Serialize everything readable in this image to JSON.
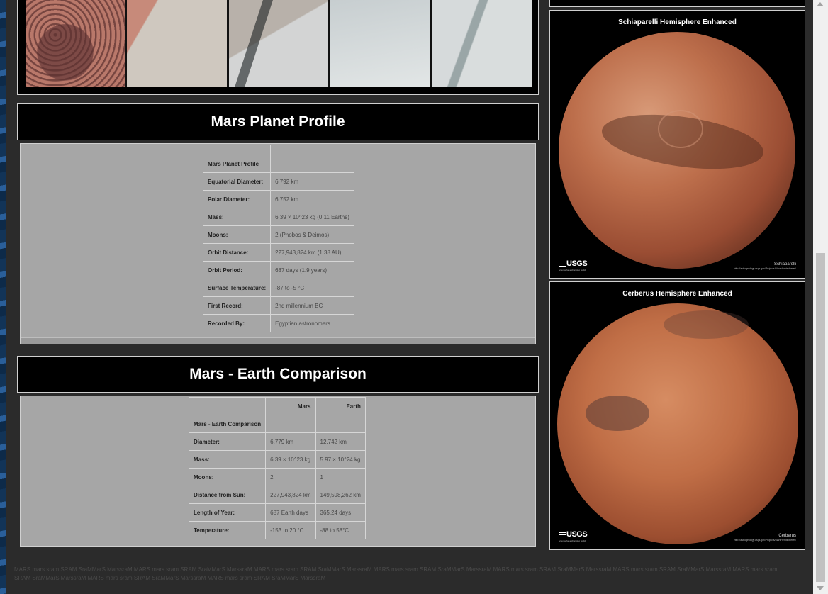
{
  "profile": {
    "heading": "Mars Planet Profile",
    "table_title": "Mars Planet Profile",
    "rows": [
      {
        "key": "Equatorial Diameter:",
        "value": "6,792 km"
      },
      {
        "key": "Polar Diameter:",
        "value": "6,752 km"
      },
      {
        "key": "Mass:",
        "value": "6.39 × 10^23 kg (0.11 Earths)"
      },
      {
        "key": "Moons:",
        "value": "2 (Phobos & Deimos)"
      },
      {
        "key": "Orbit Distance:",
        "value": "227,943,824 km (1.38 AU)"
      },
      {
        "key": "Orbit Period:",
        "value": "687 days (1.9 years)"
      },
      {
        "key": "Surface Temperature:",
        "value": "-87 to -5 °C"
      },
      {
        "key": "First Record:",
        "value": "2nd millennium BC"
      },
      {
        "key": "Recorded By:",
        "value": "Egyptian astronomers"
      }
    ]
  },
  "comparison": {
    "heading": "Mars - Earth Comparison",
    "columns": [
      "Mars",
      "Earth"
    ],
    "table_title": "Mars - Earth Comparison",
    "rows": [
      {
        "key": "Diameter:",
        "mars": "6,779 km",
        "earth": "12,742 km"
      },
      {
        "key": "Mass:",
        "mars": "6.39 × 10^23 kg",
        "earth": "5.97 × 10^24 kg"
      },
      {
        "key": "Moons:",
        "mars": "2",
        "earth": "1"
      },
      {
        "key": "Distance from Sun:",
        "mars": "227,943,824 km",
        "earth": "149,598,262 km"
      },
      {
        "key": "Length of Year:",
        "mars": "687 Earth days",
        "earth": "365.24 days"
      },
      {
        "key": "Temperature:",
        "mars": "-153 to 20 °C",
        "earth": "-88 to 58°C"
      }
    ]
  },
  "hemispheres": [
    {
      "title": "Schiaparelli Hemisphere Enhanced",
      "logo": "USGS",
      "caption": "Schiaparelli",
      "url": "http://astrogeology.usgs.gov/Projects/MarsHemispheres/"
    },
    {
      "title": "Cerberus Hemisphere Enhanced",
      "logo": "USGS",
      "caption": "Cerberus",
      "url": "http://astrogeology.usgs.gov/Projects/MarsHemispheres/"
    }
  ],
  "footer": "MARS mars sram SRAM SraMMarS MarssraM MARS mars sram SRAM SraMMarS MarssraM MARS mars sram SRAM SraMMarS MarssraM MARS mars sram SRAM SraMMarS MarssraM MARS mars sram SRAM SraMMarS MarssraM MARS mars sram SRAM SraMMarS MarssraM MARS mars sram SRAM SraMMarS MarssraM MARS mars sram SRAM SraMMarS MarssraM MARS mars sram SRAM SraMMarS MarssraM",
  "colors": {
    "page": "#2b2b2b",
    "panel": "#a6a6a6",
    "header": "#000000",
    "mars": "#b8694a"
  }
}
